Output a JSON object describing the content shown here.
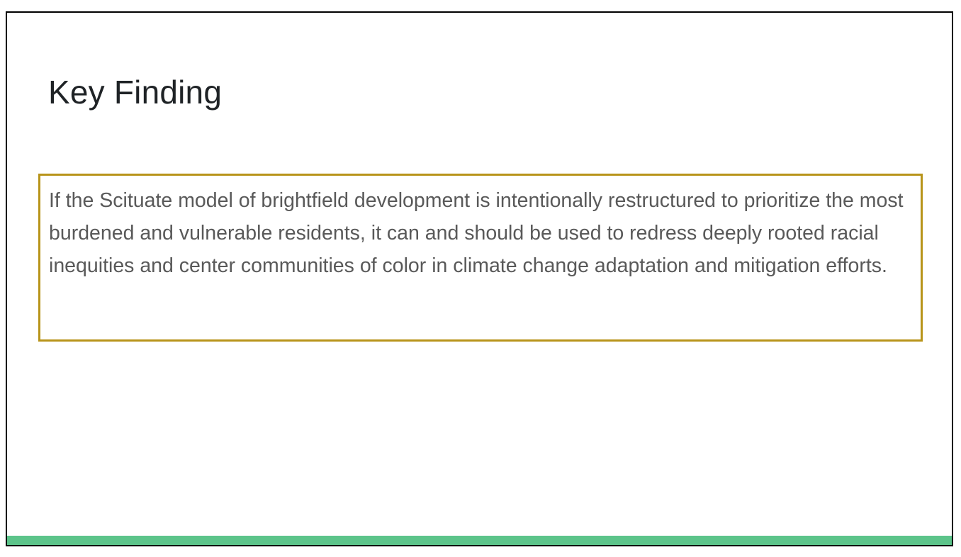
{
  "slide": {
    "title": "Key Finding",
    "finding_text": "If the Scituate model of brightfield development is intentionally restructured to prioritize the most burdened and vulnerable residents, it can and should be used to redress deeply rooted racial inequities and center communities of color in climate change adaptation and mitigation efforts."
  },
  "colors": {
    "title_text": "#1f2326",
    "body_text": "#595959",
    "box_border": "#b8941a",
    "accent_bar": "#5cc48a",
    "slide_border": "#000000"
  }
}
